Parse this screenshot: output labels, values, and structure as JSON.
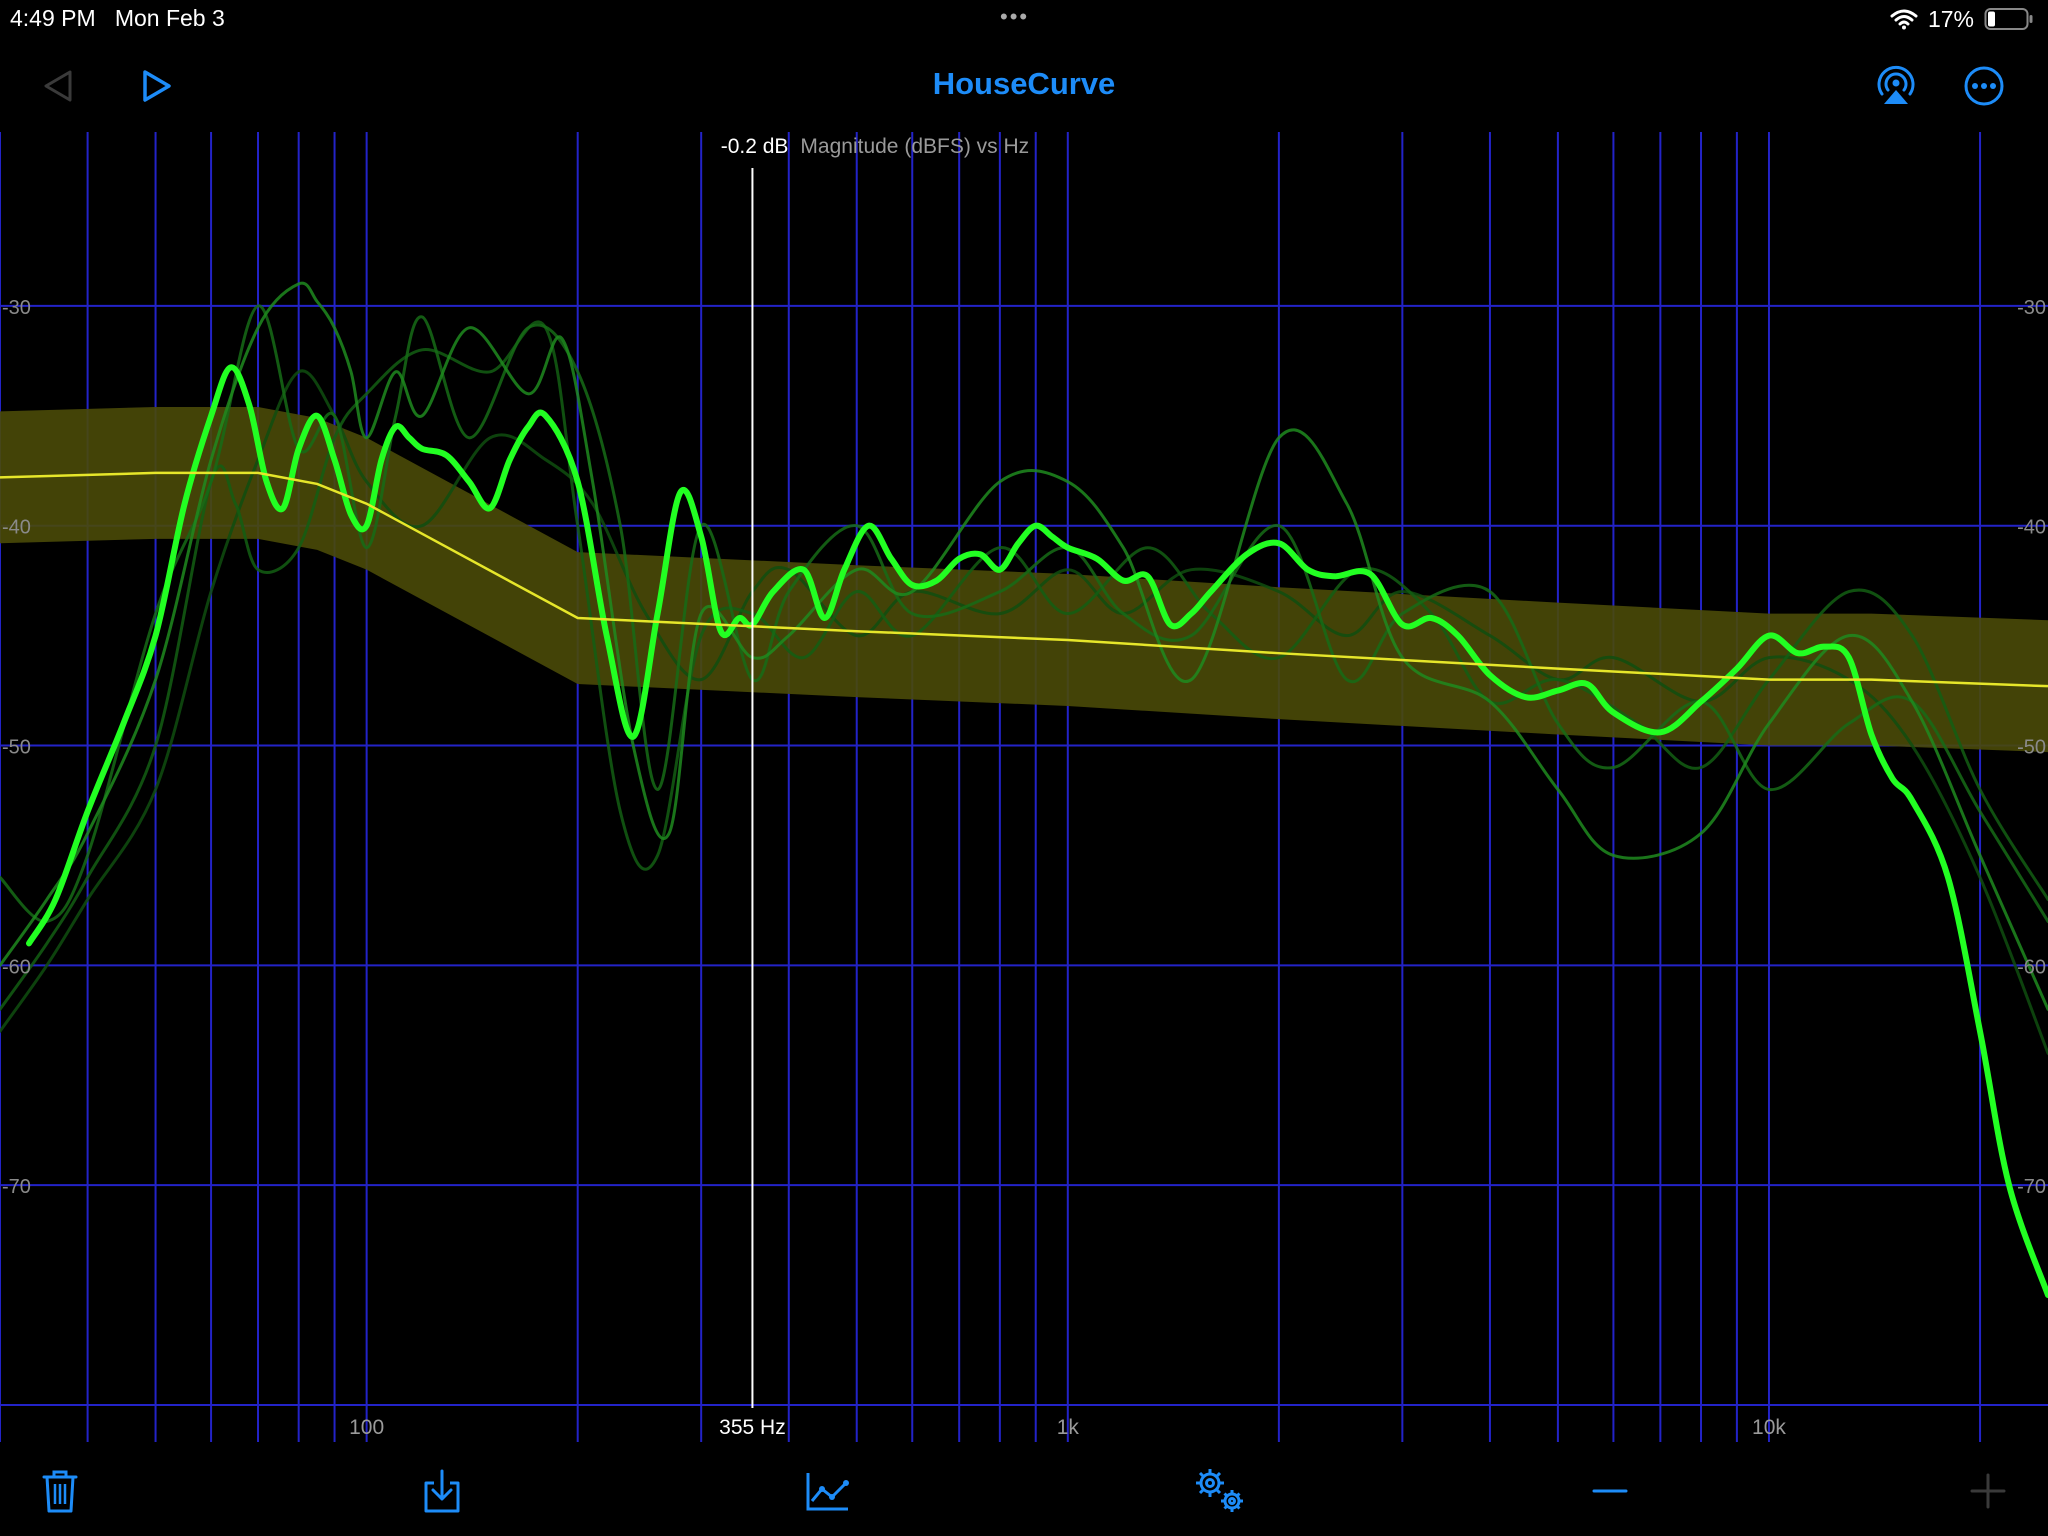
{
  "status_bar": {
    "time": "4:49 PM",
    "date": "Mon Feb 3",
    "battery": "17%",
    "more_dots": "•••"
  },
  "nav": {
    "title": "HouseCurve"
  },
  "chart_data": {
    "type": "line",
    "title": "Magnitude (dBFS) vs Hz",
    "xscale": "log",
    "xlim": [
      30,
      25000
    ],
    "ylim": [
      -80,
      -22
    ],
    "x_tick_labels": [
      {
        "hz": 100,
        "label": "100"
      },
      {
        "hz": 1000,
        "label": "1k"
      },
      {
        "hz": 10000,
        "label": "10k"
      }
    ],
    "y_ticks": [
      -30,
      -40,
      -50,
      -60,
      -70
    ],
    "cursor": {
      "hz": 355,
      "freq_label": "355 Hz",
      "value_label": "-0.2 dB"
    },
    "target_curve": {
      "color": "#e6e62a",
      "band_color": "#4a4a08",
      "x": [
        30,
        50,
        70,
        85,
        100,
        200,
        500,
        1000,
        2000,
        5000,
        10000,
        14000,
        25000
      ],
      "y": [
        -37.8,
        -37.6,
        -37.6,
        -38.1,
        -39.0,
        -44.2,
        -44.8,
        -45.2,
        -45.8,
        -46.5,
        -47.0,
        -47.0,
        -47.3
      ],
      "band_upper": [
        -34.8,
        -34.6,
        -34.6,
        -35.1,
        -36.0,
        -41.2,
        -41.8,
        -42.2,
        -42.8,
        -43.5,
        -44.0,
        -44.0,
        -44.3
      ],
      "band_lower": [
        -40.8,
        -40.6,
        -40.6,
        -41.1,
        -42.0,
        -47.2,
        -47.8,
        -48.2,
        -48.8,
        -49.5,
        -50.0,
        -50.0,
        -50.3
      ]
    },
    "series": [
      {
        "color": "#22ff22",
        "x": [
          33,
          36,
          40,
          45,
          50,
          55,
          60,
          64,
          68,
          72,
          76,
          80,
          85,
          90,
          95,
          100,
          105,
          110,
          115,
          120,
          130,
          140,
          150,
          160,
          170,
          180,
          200,
          220,
          240,
          260,
          280,
          300,
          320,
          340,
          355,
          380,
          420,
          450,
          480,
          520,
          560,
          600,
          650,
          700,
          750,
          800,
          850,
          900,
          950,
          1000,
          1100,
          1200,
          1300,
          1400,
          1500,
          1600,
          1800,
          2000,
          2200,
          2400,
          2700,
          3000,
          3300,
          3600,
          4000,
          4500,
          5000,
          5500,
          6000,
          7000,
          8000,
          9000,
          10000,
          11000,
          12000,
          13000,
          14000,
          15000,
          16000,
          18000,
          20000,
          22000,
          25000
        ],
        "y": [
          -59,
          -57,
          -53,
          -49,
          -45,
          -39,
          -35,
          -32.8,
          -34.5,
          -38,
          -39.2,
          -36.5,
          -35,
          -37,
          -39.5,
          -40,
          -37,
          -35.5,
          -36,
          -36.5,
          -36.8,
          -38,
          -39.2,
          -37,
          -35.5,
          -35,
          -38,
          -45,
          -49.6,
          -44,
          -38.5,
          -40.5,
          -44.8,
          -44.2,
          -44.5,
          -43,
          -42,
          -44.2,
          -42,
          -40,
          -41.5,
          -42.7,
          -42.5,
          -41.5,
          -41.3,
          -42,
          -40.8,
          -40,
          -40.5,
          -41,
          -41.5,
          -42.5,
          -42.3,
          -44.5,
          -44,
          -43,
          -41.3,
          -40.8,
          -42,
          -42.3,
          -42.2,
          -44.5,
          -44.2,
          -45,
          -46.8,
          -47.8,
          -47.5,
          -47.2,
          -48.5,
          -49.4,
          -48,
          -46.5,
          -45,
          -45.8,
          -45.5,
          -46,
          -49.5,
          -51.5,
          -52.5,
          -56,
          -63,
          -70,
          -75
        ]
      },
      {
        "color": "#1f8a1f",
        "x": [
          30,
          35,
          40,
          50,
          60,
          70,
          80,
          85,
          90,
          95,
          100,
          110,
          120,
          140,
          170,
          190,
          210,
          240,
          270,
          300,
          355,
          400,
          500,
          600,
          800,
          1000,
          1200,
          1500,
          2000,
          2500,
          3000,
          4000,
          5000,
          6000,
          8000,
          10000,
          13000,
          16000,
          20000,
          25000
        ],
        "y": [
          -60,
          -57,
          -54,
          -47,
          -37,
          -31,
          -29,
          -29.8,
          -31,
          -33,
          -36,
          -33,
          -35,
          -31,
          -34,
          -31.5,
          -38,
          -50,
          -54,
          -44,
          -46,
          -45,
          -42,
          -43,
          -38,
          -38,
          -41,
          -47,
          -36,
          -39,
          -46,
          -48,
          -52,
          -55,
          -54,
          -49,
          -45,
          -48,
          -55,
          -62
        ]
      },
      {
        "color": "#166b16",
        "x": [
          30,
          35,
          40,
          50,
          60,
          70,
          80,
          90,
          100,
          110,
          120,
          140,
          170,
          200,
          230,
          260,
          300,
          355,
          400,
          500,
          600,
          800,
          1000,
          1200,
          1500,
          2000,
          2500,
          3000,
          4000,
          5000,
          6000,
          8000,
          10000,
          13000,
          16000,
          20000,
          25000
        ],
        "y": [
          -56,
          -58,
          -55,
          -44,
          -38,
          -30,
          -36.5,
          -35,
          -41,
          -35,
          -30.5,
          -36,
          -31,
          -33,
          -40,
          -52,
          -40,
          -47,
          -43,
          -40,
          -44,
          -43,
          -41,
          -44,
          -45,
          -40,
          -47,
          -44,
          -43,
          -49,
          -51,
          -48,
          -52,
          -49,
          -48,
          -53,
          -58
        ]
      },
      {
        "color": "#135e13",
        "x": [
          30,
          35,
          40,
          50,
          60,
          65,
          70,
          80,
          90,
          100,
          120,
          150,
          180,
          200,
          230,
          260,
          300,
          355,
          420,
          500,
          600,
          800,
          1000,
          1300,
          1600,
          2000,
          2600,
          3300,
          4000,
          5000,
          6500,
          8000,
          10000,
          13000,
          16000,
          20000,
          25000
        ],
        "y": [
          -62,
          -59,
          -56,
          -50,
          -38,
          -39,
          -42,
          -41,
          -36,
          -34,
          -32,
          -33,
          -31,
          -40,
          -53,
          -55,
          -45,
          -44,
          -46,
          -43,
          -45,
          -41,
          -44,
          -41,
          -44,
          -46,
          -42,
          -44,
          -48,
          -47,
          -49,
          -51,
          -47,
          -43,
          -45,
          -52,
          -57
        ]
      },
      {
        "color": "#0f4e0f",
        "x": [
          30,
          35,
          40,
          50,
          60,
          70,
          80,
          90,
          100,
          120,
          150,
          180,
          210,
          250,
          300,
          355,
          400,
          500,
          600,
          800,
          1000,
          1200,
          1500,
          2000,
          2500,
          3000,
          4000,
          5000,
          6000,
          8000,
          10000,
          13000,
          16000,
          20000,
          25000
        ],
        "y": [
          -63,
          -60,
          -57,
          -52,
          -43,
          -37,
          -33,
          -35,
          -38,
          -40,
          -36,
          -37,
          -39,
          -44,
          -47,
          -43,
          -42,
          -45,
          -43,
          -44,
          -42,
          -44,
          -42,
          -43,
          -45,
          -43,
          -45,
          -47,
          -46,
          -48,
          -46,
          -47,
          -50,
          -56,
          -64
        ]
      }
    ]
  },
  "toolbar": {
    "items": [
      {
        "name": "trash-icon"
      },
      {
        "name": "import-icon"
      },
      {
        "name": "chart-line-icon"
      },
      {
        "name": "settings-gears-icon"
      },
      {
        "name": "minus-icon"
      },
      {
        "name": "plus-icon"
      }
    ]
  }
}
